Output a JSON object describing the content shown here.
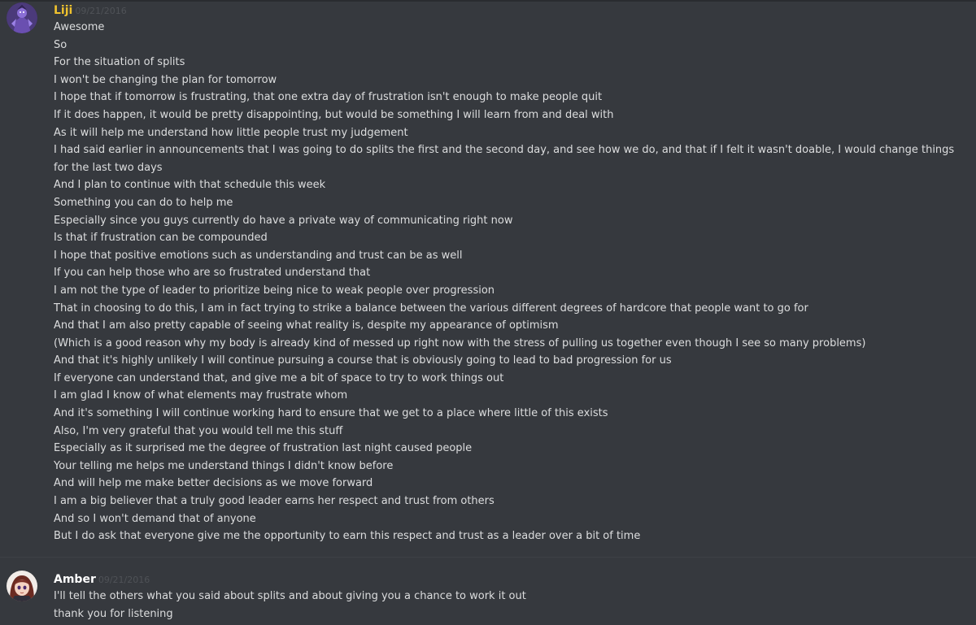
{
  "colors": {
    "background": "#36393e",
    "text": "#dcddde",
    "timestamp": "#4f5257",
    "liji_name": "#f0c22e",
    "amber_name": "#ffffff"
  },
  "messages": [
    {
      "author": "Liji",
      "timestamp": "09/21/2016",
      "avatar_icon": "purple-character-avatar",
      "lines": [
        "Awesome",
        "So",
        "For the situation of splits",
        "I won't be changing the plan for tomorrow",
        "I hope that if tomorrow is frustrating, that one extra day of frustration isn't enough to make people quit",
        "If it does happen, it would be pretty disappointing, but would be something I will learn from and deal with",
        "As it will help me understand how little people trust my judgement",
        "I had said earlier in announcements that I was going to do splits the first and the second day, and see how we do, and that if I felt it wasn't doable, I would change things for the last two days",
        "And I plan to continue with that schedule this week",
        "Something you can do to help me",
        "Especially since you guys currently do have a private way of communicating right now",
        "Is that if frustration can be compounded",
        "I hope that positive emotions such as understanding and trust can be as well",
        "If you can help those who are so frustrated understand that",
        "I am not the type of leader to prioritize being nice to weak people over progression",
        "That in choosing to do this, I am in fact trying to strike a balance between the various different degrees of hardcore that people want to go for",
        "And that I am also pretty capable of seeing what reality is, despite my appearance of optimism",
        "(Which is a good reason why my body is already kind of messed up right now with the stress of pulling us together even though I see so many problems)",
        "And that it's highly unlikely I will continue pursuing a course that is obviously going to lead to bad progression for us",
        "If everyone can understand that, and give me a bit of space to try to work things out",
        "I am glad I know of what elements may frustrate whom",
        "And it's something I will continue working hard to ensure that we get to a place where little of this exists",
        "Also, I'm very grateful that you would tell me this stuff",
        "Especially as it surprised me the degree of frustration last night caused people",
        "Your telling me helps me understand things I didn't know before",
        "And will help me make better decisions as we move forward",
        "I am a big believer that a truly good leader earns her respect and trust from others",
        "And so I won't demand that of anyone",
        "But I do ask that everyone give me the opportunity to earn this respect and trust as a leader over a bit of time"
      ]
    },
    {
      "author": "Amber",
      "timestamp": "09/21/2016",
      "avatar_icon": "anime-girl-avatar",
      "lines": [
        "I'll tell the others what you said about splits and about giving you a chance to work it out",
        "thank you for listening"
      ]
    }
  ]
}
